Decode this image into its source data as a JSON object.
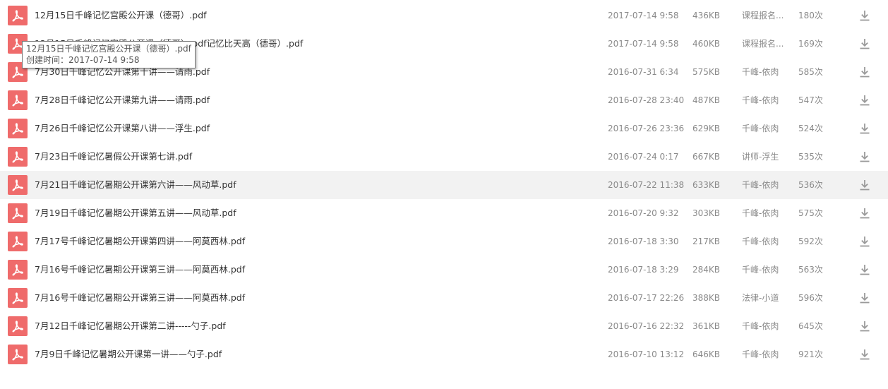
{
  "colors": {
    "pdf_icon_bg": "#ef6b6b",
    "meta_text": "#8a8a8a",
    "name_text": "#333333",
    "hover_row_bg": "#f2f2f2",
    "download_icon": "#9a9a9a"
  },
  "files": [
    {
      "name": "12月15日千峰记忆宫殿公开课（德哥）.pdf",
      "date": "2017-07-14 9:58",
      "size": "436KB",
      "uploader": "课程报名...",
      "count": "180次",
      "icon": "pdf-icon",
      "action_icon": "download-icon"
    },
    {
      "name": "12月15日千峰记忆宫殿公开课（德哥）.pdf记忆比天高（德哥）.pdf",
      "date": "2017-07-14 9:58",
      "size": "460KB",
      "uploader": "课程报名...",
      "count": "169次",
      "icon": "pdf-icon",
      "action_icon": "download-icon"
    },
    {
      "name": "7月30日千峰记忆公开课第十讲——请雨.pdf",
      "date": "2016-07-31 6:34",
      "size": "575KB",
      "uploader": "千峰-依肉",
      "count": "585次",
      "icon": "pdf-icon",
      "action_icon": "download-icon"
    },
    {
      "name": "7月28日千峰记忆公开课第九讲——请雨.pdf",
      "date": "2016-07-28 23:40",
      "size": "487KB",
      "uploader": "千峰-依肉",
      "count": "547次",
      "icon": "pdf-icon",
      "action_icon": "download-icon"
    },
    {
      "name": "7月26日千峰记忆公开课第八讲——浮生.pdf",
      "date": "2016-07-26 23:36",
      "size": "629KB",
      "uploader": "千峰-依肉",
      "count": "524次",
      "icon": "pdf-icon",
      "action_icon": "download-icon"
    },
    {
      "name": "7月23日千峰记忆暑假公开课第七讲.pdf",
      "date": "2016-07-24 0:17",
      "size": "667KB",
      "uploader": "讲师-浮生",
      "count": "535次",
      "icon": "pdf-icon",
      "action_icon": "download-icon"
    },
    {
      "name": "7月21日千峰记忆暑期公开课第六讲——风动草.pdf",
      "date": "2016-07-22 11:38",
      "size": "633KB",
      "uploader": "千峰-依肉",
      "count": "536次",
      "icon": "pdf-icon",
      "action_icon": "download-icon",
      "hovered": true
    },
    {
      "name": "7月19日千峰记忆暑期公开课第五讲——风动草.pdf",
      "date": "2016-07-20 9:32",
      "size": "303KB",
      "uploader": "千峰-依肉",
      "count": "575次",
      "icon": "pdf-icon",
      "action_icon": "download-icon"
    },
    {
      "name": "7月17号千峰记忆暑期公开课第四讲——阿莫西林.pdf",
      "date": "2016-07-18 3:30",
      "size": "217KB",
      "uploader": "千峰-依肉",
      "count": "592次",
      "icon": "pdf-icon",
      "action_icon": "download-icon"
    },
    {
      "name": "7月16号千峰记忆暑期公开课第三讲——阿莫西林.pdf",
      "date": "2016-07-18 3:29",
      "size": "284KB",
      "uploader": "千峰-依肉",
      "count": "563次",
      "icon": "pdf-icon",
      "action_icon": "download-icon"
    },
    {
      "name": "7月16号千峰记忆暑期公开课第三讲——阿莫西林.pdf",
      "date": "2016-07-17 22:26",
      "size": "388KB",
      "uploader": "法律-小道",
      "count": "596次",
      "icon": "pdf-icon",
      "action_icon": "download-icon"
    },
    {
      "name": "7月12日千峰记忆暑期公开课第二讲-----勺子.pdf",
      "date": "2016-07-16 22:32",
      "size": "361KB",
      "uploader": "千峰-依肉",
      "count": "645次",
      "icon": "pdf-icon",
      "action_icon": "download-icon"
    },
    {
      "name": "7月9日千峰记忆暑期公开课第一讲——勺子.pdf",
      "date": "2016-07-10 13:12",
      "size": "646KB",
      "uploader": "千峰-依肉",
      "count": "921次",
      "icon": "pdf-icon",
      "action_icon": "download-icon"
    }
  ],
  "tooltip": {
    "title": "12月15日千峰记忆宫殿公开课（德哥）.pdf",
    "created": "创建时间：2017-07-14 9:58"
  }
}
